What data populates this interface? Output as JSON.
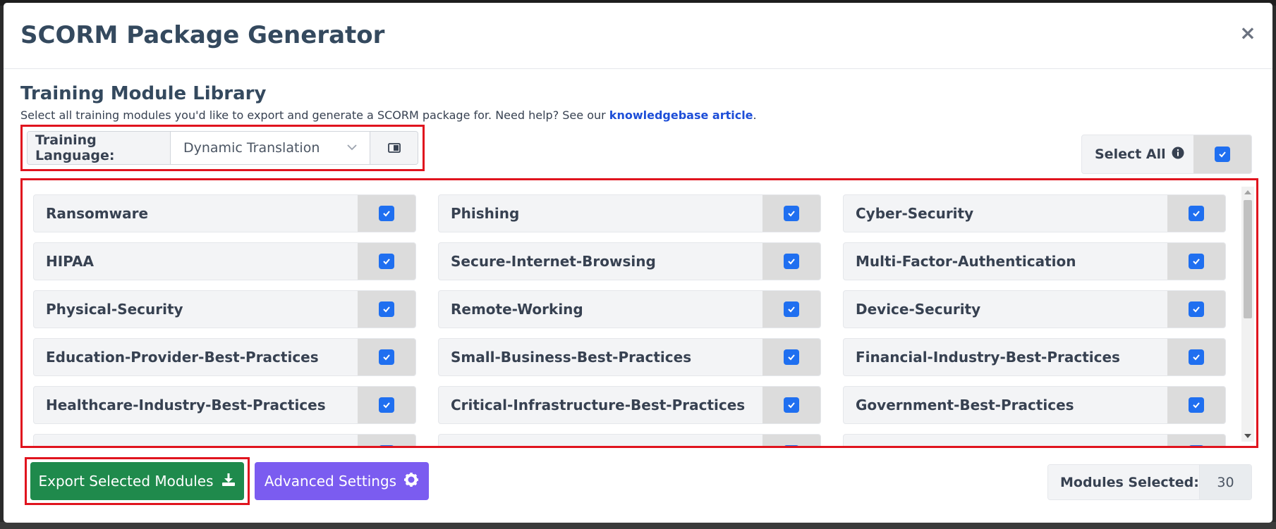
{
  "modal": {
    "title": "SCORM Package Generator",
    "close_label": "×"
  },
  "library": {
    "title": "Training Module Library",
    "description_prefix": "Select all training modules you'd like to export and generate a SCORM package for. Need help? See our ",
    "link_text": "knowledgebase article",
    "description_suffix": "."
  },
  "language": {
    "label": "Training Language:",
    "selected": "Dynamic Translation"
  },
  "select_all": {
    "label": "Select All",
    "checked": true
  },
  "modules": [
    {
      "label": "Ransomware",
      "checked": true
    },
    {
      "label": "Phishing",
      "checked": true
    },
    {
      "label": "Cyber-Security",
      "checked": true
    },
    {
      "label": "HIPAA",
      "checked": true
    },
    {
      "label": "Secure-Internet-Browsing",
      "checked": true
    },
    {
      "label": "Multi-Factor-Authentication",
      "checked": true
    },
    {
      "label": "Physical-Security",
      "checked": true
    },
    {
      "label": "Remote-Working",
      "checked": true
    },
    {
      "label": "Device-Security",
      "checked": true
    },
    {
      "label": "Education-Provider-Best-Practices",
      "checked": true
    },
    {
      "label": "Small-Business-Best-Practices",
      "checked": true
    },
    {
      "label": "Financial-Industry-Best-Practices",
      "checked": true
    },
    {
      "label": "Healthcare-Industry-Best-Practices",
      "checked": true
    },
    {
      "label": "Critical-Infrastructure-Best-Practices",
      "checked": true
    },
    {
      "label": "Government-Best-Practices",
      "checked": true
    },
    {
      "label": "",
      "checked": true
    },
    {
      "label": "",
      "checked": true
    },
    {
      "label": "",
      "checked": true
    }
  ],
  "actions": {
    "export_label": "Export Selected Modules",
    "advanced_label": "Advanced Settings"
  },
  "summary": {
    "label": "Modules Selected:",
    "count": "30"
  },
  "colors": {
    "accent_blue": "#1f6ff0",
    "export_green": "#1f8a4c",
    "advanced_purple": "#7b5cf0",
    "highlight_red": "#e0141e"
  },
  "icons": {
    "close": "close-icon",
    "chevron": "chevron-down-icon",
    "book": "book-icon",
    "info": "info-icon",
    "download": "download-icon",
    "gear": "gear-icon",
    "check": "check-icon"
  }
}
